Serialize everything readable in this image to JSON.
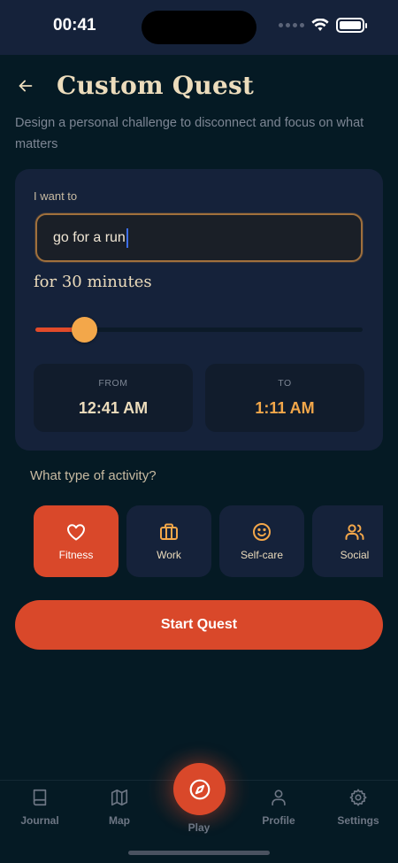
{
  "status_bar": {
    "time": "00:41"
  },
  "header": {
    "title": "Custom Quest",
    "subtitle": "Design a personal challenge to disconnect and focus on what matters"
  },
  "quest": {
    "want_label": "I want to",
    "activity_value": "go for a run",
    "duration_text": "for 30 minutes",
    "duration_fraction": 0.15,
    "from_label": "FROM",
    "from_time": "12:41 AM",
    "to_label": "TO",
    "to_time": "1:11 AM"
  },
  "activity_type": {
    "question": "What type of activity?",
    "options": [
      {
        "label": "Fitness",
        "icon": "heart-icon",
        "selected": true
      },
      {
        "label": "Work",
        "icon": "briefcase-icon",
        "selected": false
      },
      {
        "label": "Self-care",
        "icon": "smile-icon",
        "selected": false
      },
      {
        "label": "Social",
        "icon": "users-icon",
        "selected": false
      }
    ]
  },
  "start_button": {
    "label": "Start Quest"
  },
  "tab_bar": {
    "items": [
      {
        "label": "Journal",
        "icon": "book-icon"
      },
      {
        "label": "Map",
        "icon": "map-icon"
      },
      {
        "label": "Play",
        "icon": "compass-icon",
        "active": true
      },
      {
        "label": "Profile",
        "icon": "user-icon"
      },
      {
        "label": "Settings",
        "icon": "gear-icon"
      }
    ]
  },
  "colors": {
    "background": "#051a24",
    "card": "#15223a",
    "accent": "#d9482a",
    "highlight": "#f3a74a",
    "title": "#ecdcbc",
    "muted": "#7d8694"
  }
}
